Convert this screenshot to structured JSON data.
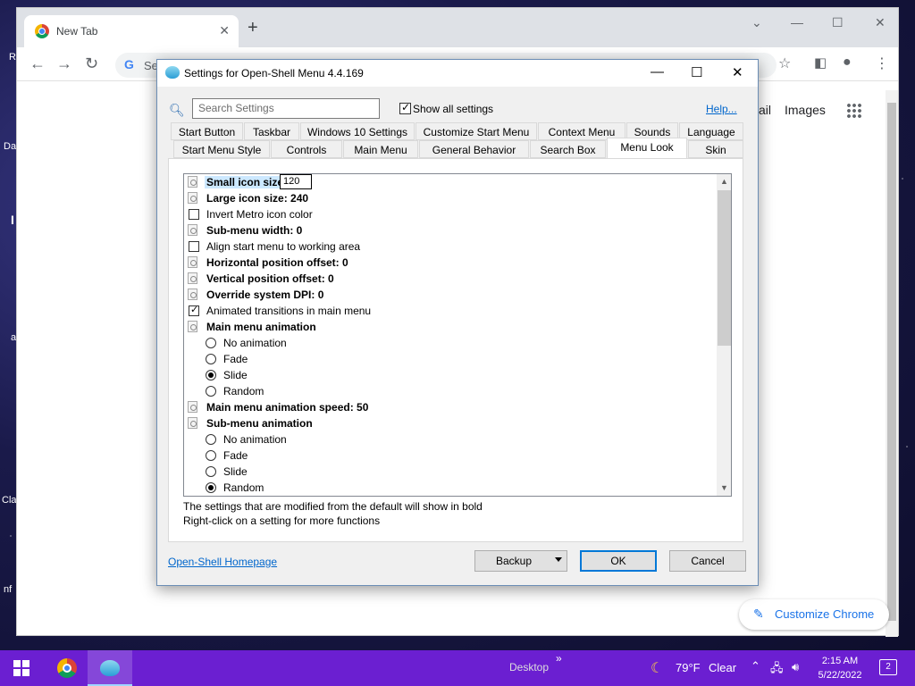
{
  "desktop": {
    "left_labels": [
      "R",
      "Da",
      "I",
      "a",
      "Cla",
      "nf"
    ]
  },
  "chrome": {
    "tab_title": "New Tab",
    "tab_close": "✕",
    "new_tab": "+",
    "omnibox_prefix": "G",
    "omnibox_text": "Se",
    "link_mail": "ail",
    "link_images": "Images",
    "customize_label": "Customize Chrome"
  },
  "dialog": {
    "title": "Settings for Open-Shell Menu 4.4.169",
    "search_placeholder": "Search Settings",
    "show_all_label": "Show all settings",
    "show_all_checked": true,
    "help_label": "Help...",
    "tabs_row1": [
      "Start Button",
      "Taskbar",
      "Windows 10 Settings",
      "Customize Start Menu",
      "Context Menu",
      "Sounds",
      "Language"
    ],
    "tabs_row2": [
      "Start Menu Style",
      "Controls",
      "Main Menu",
      "General Behavior",
      "Search Box",
      "Menu Look",
      "Skin"
    ],
    "active_tab": "Menu Look",
    "settings": [
      {
        "type": "value",
        "label": "Small icon size",
        "bold": true,
        "selected": true,
        "edit_value": "120"
      },
      {
        "type": "value",
        "label": "Large icon size: 240",
        "bold": true
      },
      {
        "type": "check",
        "label": "Invert Metro icon color",
        "checked": false
      },
      {
        "type": "value",
        "label": "Sub-menu width: 0",
        "bold": true
      },
      {
        "type": "check",
        "label": "Align start menu to working area",
        "checked": false
      },
      {
        "type": "value",
        "label": "Horizontal position offset: 0",
        "bold": true
      },
      {
        "type": "value",
        "label": "Vertical position offset: 0",
        "bold": true
      },
      {
        "type": "value",
        "label": "Override system DPI: 0",
        "bold": true
      },
      {
        "type": "check",
        "label": "Animated transitions in main menu",
        "checked": true
      },
      {
        "type": "value",
        "label": "Main menu animation",
        "bold": true
      },
      {
        "type": "radio",
        "label": "No animation",
        "on": false
      },
      {
        "type": "radio",
        "label": "Fade",
        "on": false
      },
      {
        "type": "radio",
        "label": "Slide",
        "on": true
      },
      {
        "type": "radio",
        "label": "Random",
        "on": false
      },
      {
        "type": "value",
        "label": "Main menu animation speed: 50",
        "bold": true
      },
      {
        "type": "value",
        "label": "Sub-menu animation",
        "bold": true
      },
      {
        "type": "radio",
        "label": "No animation",
        "on": false
      },
      {
        "type": "radio",
        "label": "Fade",
        "on": false
      },
      {
        "type": "radio",
        "label": "Slide",
        "on": false
      },
      {
        "type": "radio",
        "label": "Random",
        "on": true
      }
    ],
    "hint_line1": "The settings that are modified from the default will show in bold",
    "hint_line2": "Right-click on a setting for more functions",
    "homepage_link": "Open-Shell Homepage",
    "backup_label": "Backup",
    "ok_label": "OK",
    "cancel_label": "Cancel"
  },
  "taskbar": {
    "desktop_label": "Desktop",
    "desktop_chevron": "»",
    "weather_temp": "79°F",
    "weather_desc": "Clear",
    "time": "2:15 AM",
    "date": "5/22/2022",
    "notification_count": "2"
  }
}
